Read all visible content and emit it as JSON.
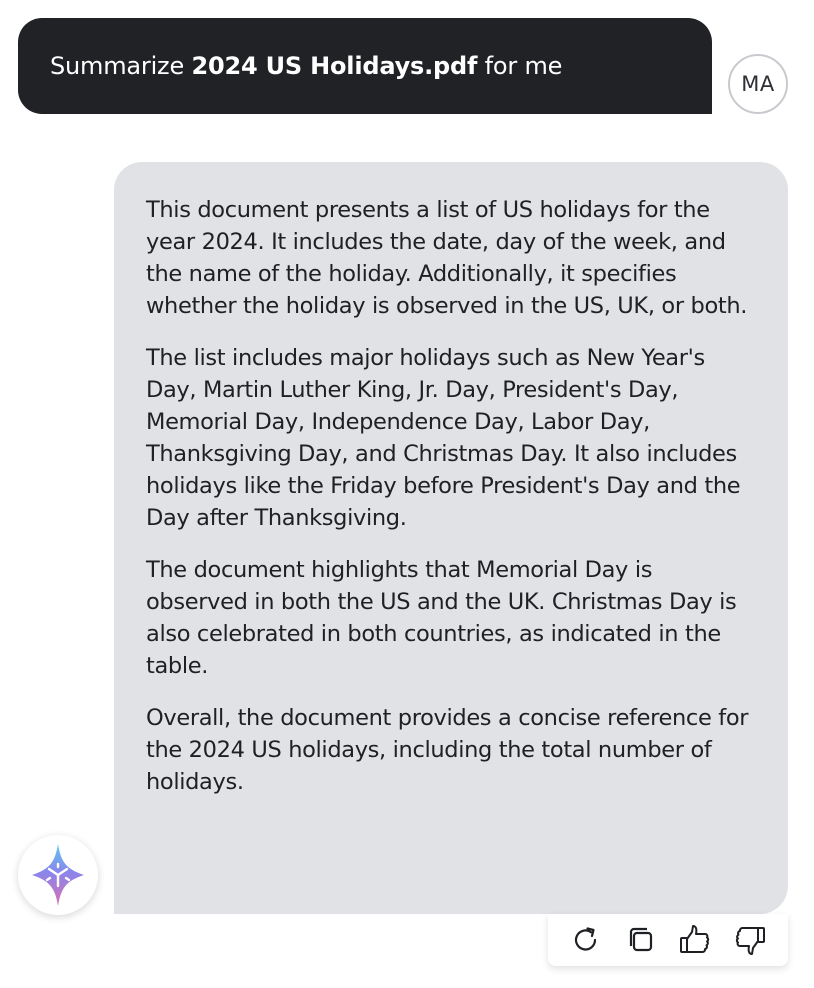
{
  "user_message": {
    "prefix": "Summarize ",
    "filename": "2024 US Holidays.pdf",
    "suffix": " for me"
  },
  "user_avatar": {
    "initials": "MA"
  },
  "assistant_message": {
    "paragraphs": [
      "This document presents a list of US holidays for the year 2024. It includes the date, day of the week, and the name of the holiday. Additionally, it specifies whether the holiday is observed in the US, UK, or both.",
      "The list includes major holidays such as New Year's Day, Martin Luther King, Jr. Day, President's Day, Memorial Day, Independence Day, Labor Day, Thanksgiving Day, and Christmas Day. It also includes holidays like the Friday before President's Day and the Day after Thanksgiving.",
      "The document highlights that Memorial Day is observed in both the US and the UK. Christmas Day is also celebrated in both countries, as indicated in the table.",
      "Overall, the document provides a concise reference for the 2024 US holidays, including the total number of holidays."
    ]
  },
  "ai_avatar": {
    "icon": "sparkle-star-icon"
  },
  "toolbar": {
    "icons": [
      "refresh-icon",
      "copy-icon",
      "thumbs-up-icon",
      "thumbs-down-icon"
    ]
  },
  "colors": {
    "user_bubble_bg": "#212226",
    "assistant_bubble_bg": "#e1e2e6",
    "text_dark": "#1f2024"
  }
}
